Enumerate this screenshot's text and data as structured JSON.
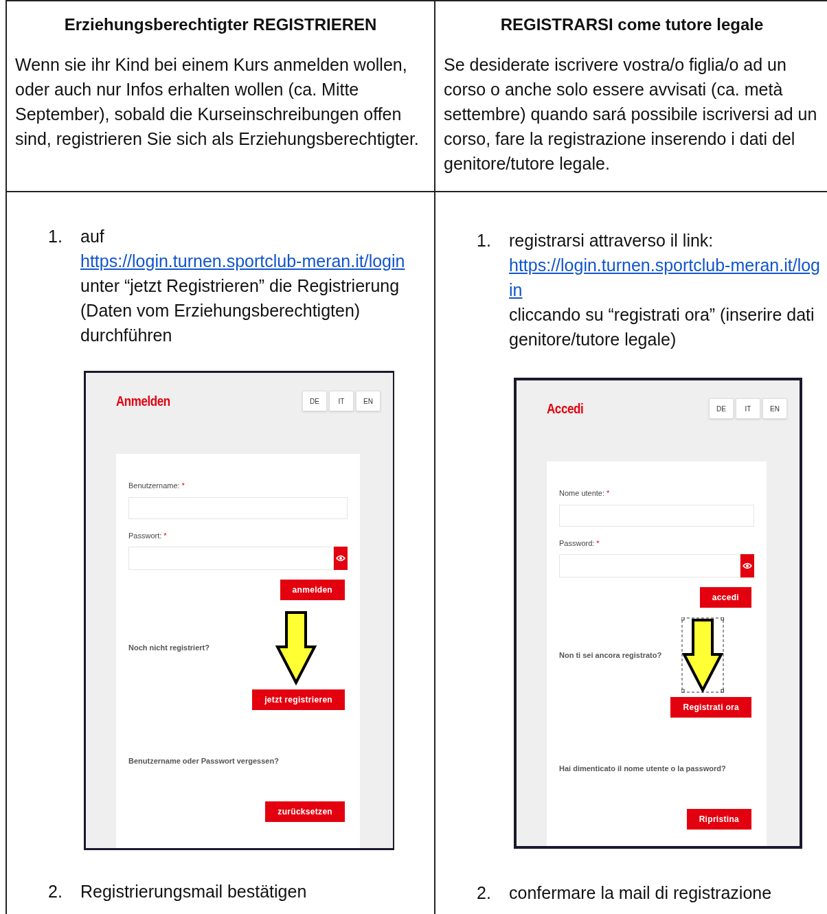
{
  "columns": [
    {
      "heading": "Erziehungsberechtigter REGISTRIEREN",
      "intro": "Wenn sie ihr Kind bei einem Kurs anmelden wollen, oder auch nur Infos erhalten wollen (ca. Mitte September), sobald die Kurseinschreibungen offen sind, registrieren Sie sich als Erziehungsberechtigter.",
      "step_1": {
        "number": "1.",
        "before": "auf",
        "link": "https://login.turnen.sportclub-meran.it/login",
        "after": "unter “jetzt Registrieren” die Registrierung (Daten vom Erziehungsberechtigten) durchführen"
      },
      "screenshot": {
        "title": "Anmelden",
        "languages": [
          "DE",
          "IT",
          "EN"
        ],
        "username_label": "Benutzername:",
        "password_label": "Passwort:",
        "required_mark": "*",
        "login_button": "anmelden",
        "register_prompt": "Noch nicht registriert?",
        "register_button": "jetzt registrieren",
        "forgot_prompt": "Benutzername oder Passwort vergessen?",
        "reset_button": "zurücksetzen",
        "arrow_selected": false
      },
      "step_2": {
        "number": "2.",
        "text": "Registrierungsmail bestätigen"
      }
    },
    {
      "heading": "REGISTRARSI come tutore legale",
      "intro": "Se desiderate iscrivere vostra/o figlia/o ad un corso o anche solo essere avvisati (ca. metà settembre) quando sará possibile iscriversi ad un corso, fare la registrazione inserendo i dati del genitore/tutore legale.",
      "step_1": {
        "number": "1.",
        "before": "registrarsi attraverso il link:",
        "link": "https://login.turnen.sportclub-meran.it/login",
        "after": "cliccando su “registrati ora” (inserire dati genitore/tutore legale)"
      },
      "screenshot": {
        "title": "Accedi",
        "languages": [
          "DE",
          "IT",
          "EN"
        ],
        "username_label": "Nome utente:",
        "password_label": "Password:",
        "required_mark": "*",
        "login_button": "accedi",
        "register_prompt": "Non ti sei ancora registrato?",
        "register_button": "Registrati ora",
        "forgot_prompt": "Hai dimenticato il nome utente o la password?",
        "reset_button": "Ripristina",
        "arrow_selected": true
      },
      "step_2": {
        "number": "2.",
        "text": "confermare la mail di registrazione"
      }
    }
  ]
}
